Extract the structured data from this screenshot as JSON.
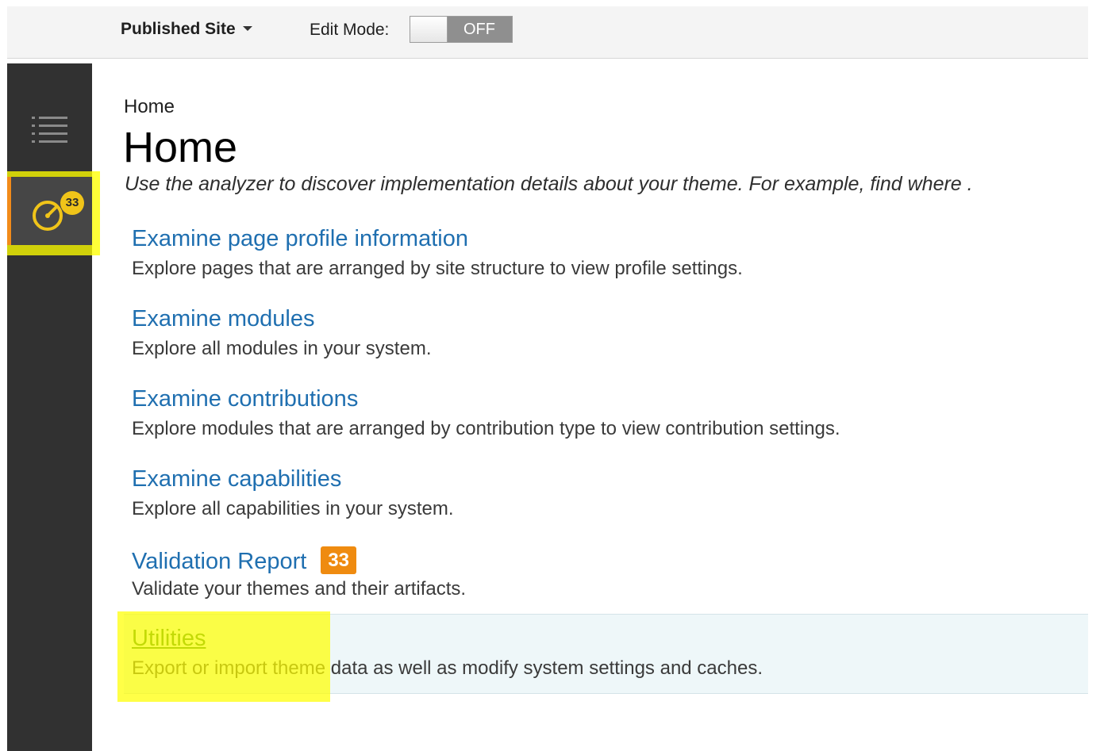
{
  "toolbar": {
    "site_label": "Published Site",
    "edit_mode_label": "Edit Mode:",
    "edit_mode_state": "OFF"
  },
  "nav": {
    "menu_icon": "menu-list-icon",
    "analyzer_icon": "gauge-icon",
    "analyzer_badge": "33",
    "active_accent": "#f28b1a"
  },
  "page": {
    "breadcrumb": "Home",
    "title": "Home",
    "subtitle": "Use the analyzer to discover implementation details about your theme. For example, find where ."
  },
  "sections": [
    {
      "title": "Examine page profile information",
      "description": "Explore pages that are arranged by site structure to view profile settings."
    },
    {
      "title": "Examine modules",
      "description": "Explore all modules in your system."
    },
    {
      "title": "Examine contributions",
      "description": "Explore modules that are arranged by contribution type to view contribution settings."
    },
    {
      "title": "Examine capabilities",
      "description": "Explore all capabilities in your system."
    },
    {
      "title": "Validation Report",
      "badge": "33",
      "description": "Validate your themes and their artifacts."
    },
    {
      "title": "Utilities",
      "description": "Export or import theme data as well as modify system settings and caches."
    }
  ],
  "colors": {
    "link": "#1f6fb0",
    "visited_link": "#2a7a16",
    "badge": "#ef8b10",
    "highlight": "#ffff00"
  }
}
